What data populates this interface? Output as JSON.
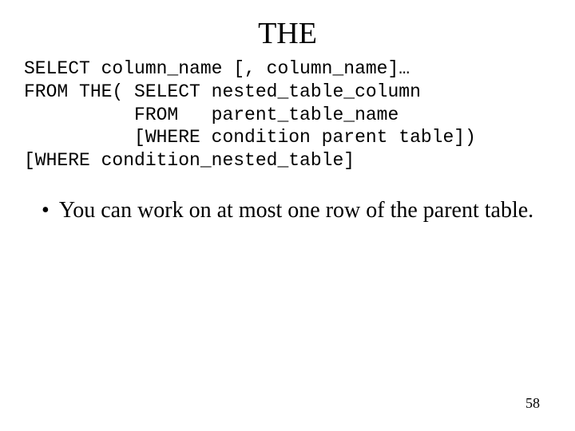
{
  "title": "THE",
  "code": {
    "line1": "SELECT column_name [, column_name]…",
    "line2": "FROM THE( SELECT nested_table_column",
    "line3": "          FROM   parent_table_name",
    "line4": "          [WHERE condition parent table])",
    "line5": "[WHERE condition_nested_table]"
  },
  "bullet": {
    "marker": "•",
    "text": "You can work on at most one row of the parent table."
  },
  "page_number": "58"
}
